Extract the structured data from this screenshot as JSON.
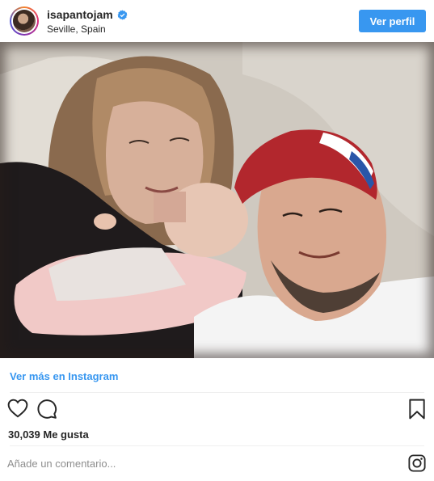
{
  "header": {
    "username": "isapantojam",
    "verified_icon": "verified-badge-icon",
    "location": "Seville, Spain",
    "view_profile_label": "Ver perfil"
  },
  "photo": {
    "subject_icon": "photo"
  },
  "footer": {
    "more_link": "Ver más en Instagram",
    "likes": "30,039 Me gusta",
    "comment_placeholder": "Añade un comentario..."
  },
  "icons": {
    "heart": "heart-icon",
    "comment": "comment-icon",
    "bookmark": "bookmark-icon",
    "instagram": "instagram-icon"
  },
  "colors": {
    "accent": "#3897f0",
    "text": "#262626",
    "muted": "#8e8e8e"
  }
}
